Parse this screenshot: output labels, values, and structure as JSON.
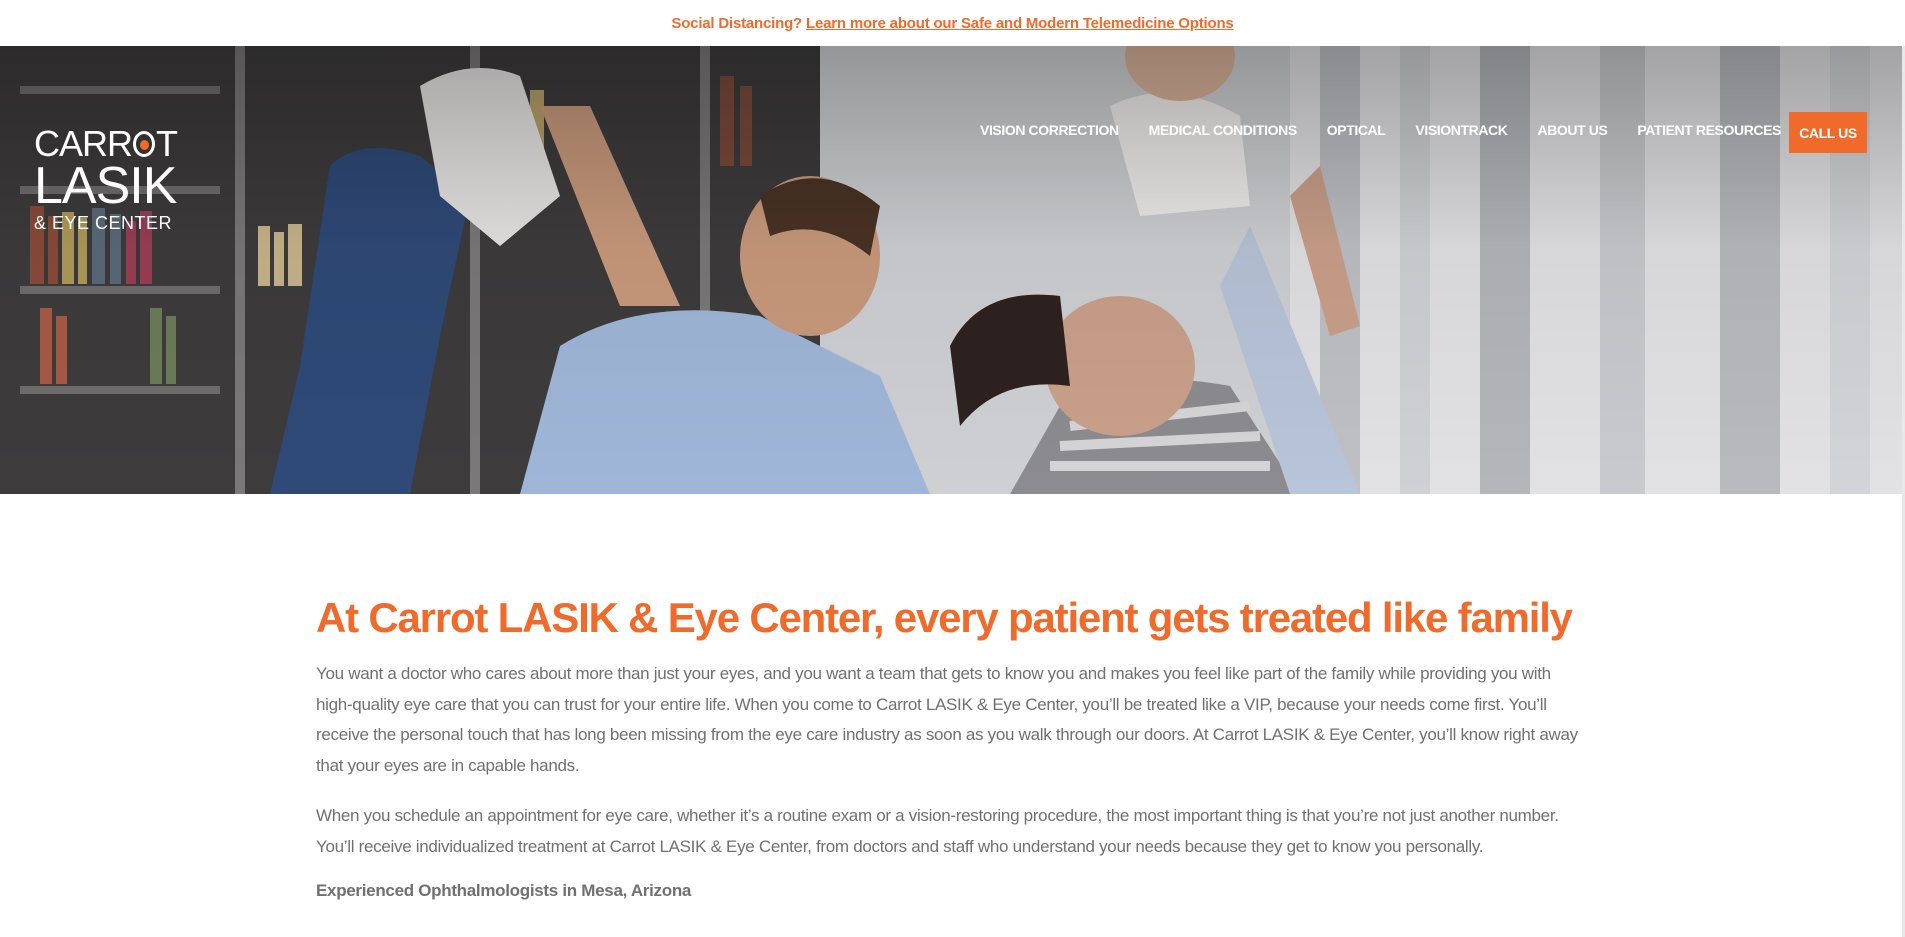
{
  "announcement": {
    "prefix": "Social Distancing?",
    "link_text": "Learn more about our Safe and Modern Telemedicine Options"
  },
  "logo": {
    "line1_a": "CARR",
    "line1_b": "T",
    "line2": "LASIK",
    "line3": "& EYE CENTER"
  },
  "nav": {
    "items": [
      "VISION CORRECTION",
      "MEDICAL CONDITIONS",
      "OPTICAL",
      "VISIONTRACK",
      "ABOUT US",
      "PATIENT RESOURCES"
    ],
    "cta": "CALL US"
  },
  "hero": {
    "image": "family-playing-photo"
  },
  "main": {
    "headline": "At Carrot LASIK & Eye Center, every patient gets treated like family",
    "paragraphs": [
      "You want a doctor who cares about more than just your eyes, and you want a team that gets to know you and makes you feel like part of the family while providing you with high-quality eye care that you can trust for your entire life. When you come to Carrot LASIK & Eye Center, you’ll be treated like a VIP, because your needs come first. You’ll receive the personal touch that has long been missing from the eye care industry as soon as you walk through our doors. At Carrot LASIK & Eye Center, you’ll know right away that your eyes are in capable hands.",
      "When you schedule an appointment for eye care, whether it’s a routine exam or a vision-restoring procedure, the most important thing is that you’re not just another number. You’ll receive individualized treatment at Carrot LASIK & Eye Center, from doctors and staff who understand your needs because they get to know you personally."
    ],
    "subheading": "Experienced Ophthalmologists in Mesa, Arizona"
  },
  "colors": {
    "brand_orange": "#ef6a2b",
    "body_text": "#707070"
  }
}
